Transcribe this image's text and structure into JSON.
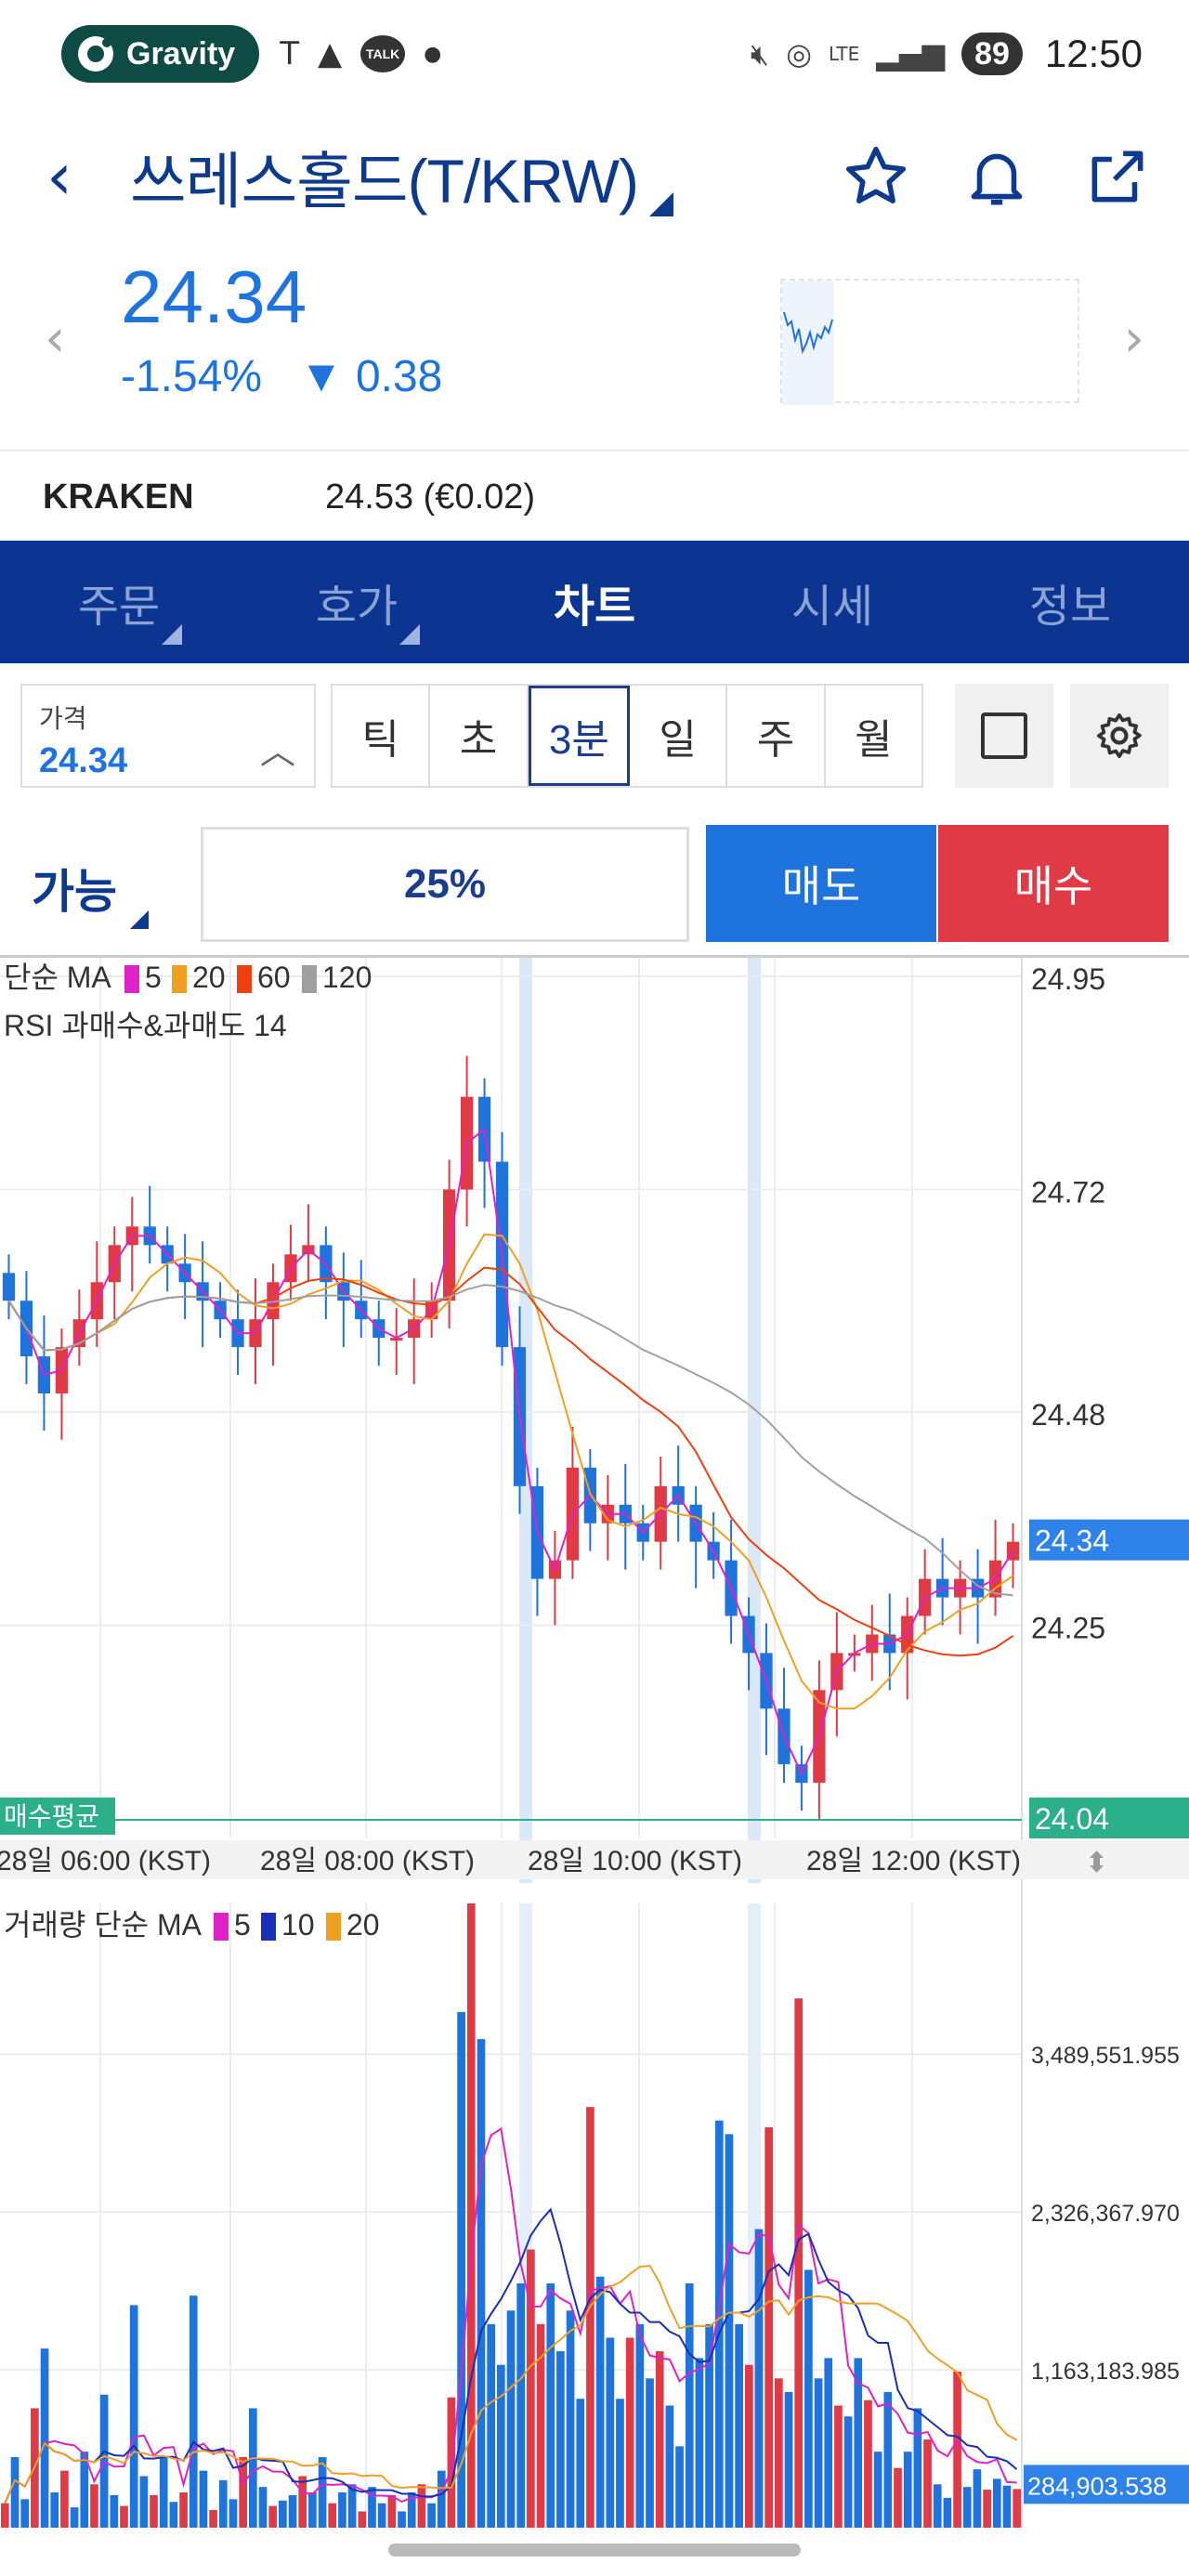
{
  "status_bar": {
    "app_pill": "Gravity",
    "talk_badge": "TALK",
    "network": "LTE",
    "battery": "89",
    "time": "12:50"
  },
  "header": {
    "title": "쓰레스홀드(T/KRW)"
  },
  "price_info": {
    "price": "24.34",
    "change_pct": "-1.54%",
    "change_abs": "▼ 0.38"
  },
  "exchange": {
    "name": "KRAKEN",
    "value": "24.53 (€0.02)"
  },
  "tabs": [
    {
      "label": "주문",
      "active": false,
      "has_menu": true
    },
    {
      "label": "호가",
      "active": false,
      "has_menu": true
    },
    {
      "label": "차트",
      "active": true,
      "has_menu": false
    },
    {
      "label": "시세",
      "active": false,
      "has_menu": false
    },
    {
      "label": "정보",
      "active": false,
      "has_menu": false
    }
  ],
  "controls": {
    "price_label": "가격",
    "price_value": "24.34",
    "intervals": [
      "틱",
      "초",
      "3분",
      "일",
      "주",
      "월"
    ],
    "active_interval": "3분"
  },
  "order": {
    "able_label": "가능",
    "percent": "25%",
    "sell_label": "매도",
    "buy_label": "매수"
  },
  "colors": {
    "up": "#e03a46",
    "down": "#1e73dc",
    "brand_navy": "#0b3590",
    "avg_buy_line": "#2bb08a",
    "ma5": "#e020c8",
    "ma20": "#f0a020",
    "ma60": "#f04010",
    "ma120": "#a0a0a0",
    "vol_ma10": "#1a2fb8"
  },
  "chart_data": [
    {
      "type": "candlestick",
      "legend_line1": {
        "prefix": "단순 MA",
        "periods": [
          "5",
          "20",
          "60",
          "120"
        ]
      },
      "legend_line2": "RSI 과매수&과매도 14",
      "y_ticks": [
        "24.95",
        "24.72",
        "24.48",
        "24.25"
      ],
      "ylim": [
        24.02,
        24.97
      ],
      "current_price_label": "24.34",
      "current_price": 24.34,
      "avg_buy_label": "매수평균",
      "avg_buy_price_label": "24.04",
      "avg_buy_price": 24.04,
      "x_ticks": [
        "28일 06:00 (KST)",
        "28일 08:00 (KST)",
        "28일 10:00 (KST)",
        "28일 12:00 (KST)"
      ],
      "price_path_approx": [
        24.6,
        24.54,
        24.5,
        24.55,
        24.58,
        24.62,
        24.66,
        24.68,
        24.66,
        24.64,
        24.62,
        24.6,
        24.58,
        24.55,
        24.58,
        24.62,
        24.65,
        24.66,
        24.62,
        24.6,
        24.58,
        24.56,
        24.56,
        24.58,
        24.6,
        24.72,
        24.82,
        24.75,
        24.55,
        24.4,
        24.3,
        24.32,
        24.42,
        24.36,
        24.38,
        24.36,
        24.34,
        24.4,
        24.38,
        24.34,
        24.32,
        24.26,
        24.22,
        24.16,
        24.1,
        24.08,
        24.18,
        24.22,
        24.22,
        24.24,
        24.22,
        24.26,
        24.3,
        24.28,
        24.3,
        24.28,
        24.32,
        24.34
      ]
    },
    {
      "type": "bar",
      "legend": {
        "prefix": "거래량 단순 MA",
        "periods": [
          "5",
          "10",
          "20"
        ]
      },
      "y_ticks": [
        "3,489,551.955",
        "2,326,367.970",
        "1,163,183.985"
      ],
      "ylim": [
        0,
        4600000
      ],
      "current_volume_label": "284,903.538",
      "current_volume": 284903.538,
      "volumes_approx": [
        180000,
        520000,
        210000,
        880000,
        1320000,
        260000,
        420000,
        150000,
        560000,
        320000,
        980000,
        240000,
        160000,
        1640000,
        380000,
        240000,
        520000,
        190000,
        260000,
        1710000,
        420000,
        130000,
        350000,
        210000,
        520000,
        880000,
        300000,
        160000,
        200000,
        240000,
        380000,
        260000,
        520000,
        180000,
        260000,
        320000,
        120000,
        300000,
        180000,
        240000,
        120000,
        260000,
        320000,
        180000,
        420000,
        960000,
        3800000,
        4600000,
        3600000,
        1500000,
        1200000,
        1600000,
        1800000,
        2050000,
        1500000,
        1800000,
        1300000,
        1600000,
        950000,
        3100000,
        1850000,
        1400000,
        950000,
        1400000,
        1500000,
        1100000,
        1300000,
        900000,
        600000,
        1800000,
        1250000,
        1500000,
        3000000,
        2900000,
        1500000,
        1200000,
        2200000,
        2950000,
        1100000,
        1000000,
        3900000,
        1900000,
        1100000,
        1250000,
        900000,
        820000,
        1250000,
        940000,
        560000,
        1000000,
        440000,
        560000,
        880000,
        650000,
        320000,
        220000,
        1150000,
        300000,
        430000,
        280000,
        360000,
        310000,
        285000
      ]
    }
  ]
}
